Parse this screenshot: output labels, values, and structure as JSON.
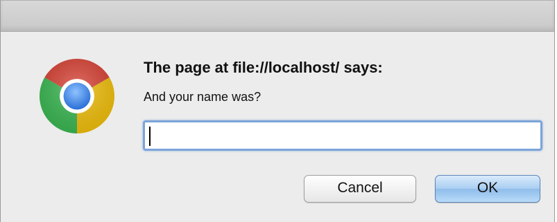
{
  "dialog": {
    "title": "The page at file://localhost/ says:",
    "message": "And your name was?",
    "input_value": "",
    "cancel_label": "Cancel",
    "ok_label": "OK",
    "icon": "chrome-logo-icon"
  },
  "colors": {
    "dialog_background": "#ececec",
    "titlebar": "#cfcfcf",
    "input_focus_ring": "#7ba4d8",
    "ok_button": "#a8cdf2",
    "chrome_red": "#db4437",
    "chrome_yellow": "#f4c20d",
    "chrome_green": "#3cba54",
    "chrome_blue": "#4285f4"
  }
}
